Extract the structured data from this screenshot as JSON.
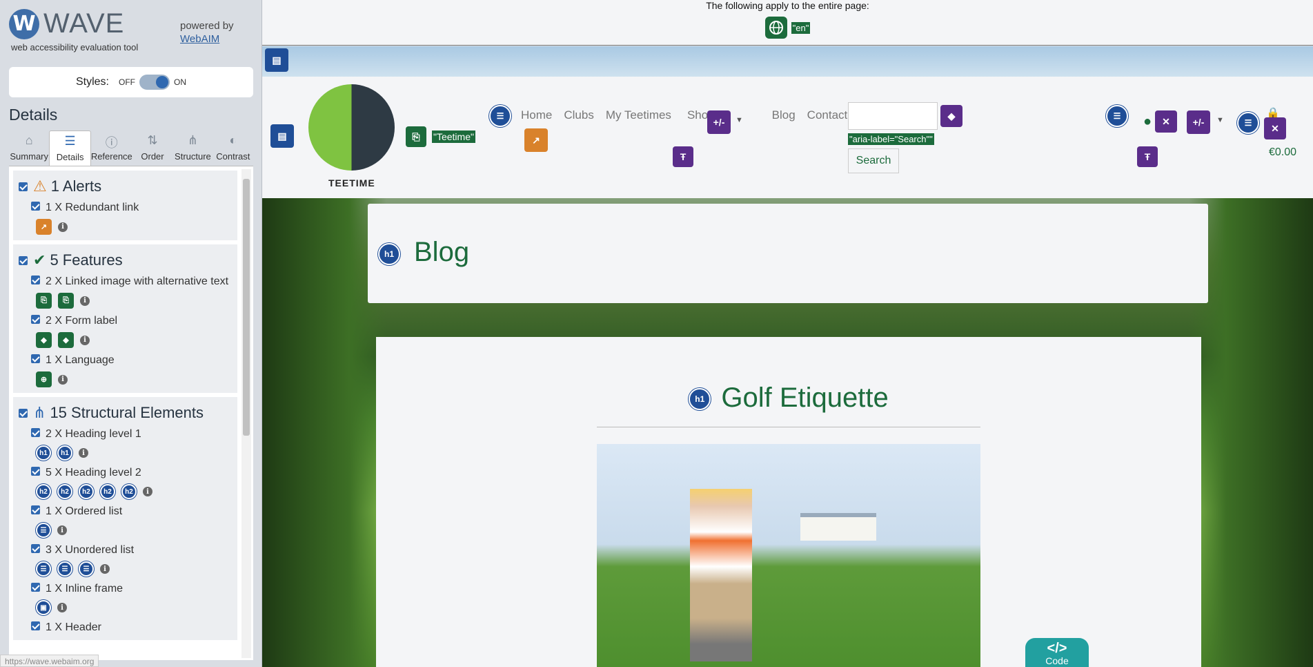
{
  "wave": {
    "logo_letter": "W",
    "logo_name": "WAVE",
    "tagline": "web accessibility evaluation tool",
    "powered_by": "powered by",
    "webaim": "WebAIM",
    "styles_label": "Styles:",
    "styles_off": "OFF",
    "styles_on": "ON",
    "details_heading": "Details",
    "tabs": [
      {
        "label": "Summary",
        "icon": "home-icon"
      },
      {
        "label": "Details",
        "icon": "list-icon"
      },
      {
        "label": "Reference",
        "icon": "info-icon"
      },
      {
        "label": "Order",
        "icon": "order-icon"
      },
      {
        "label": "Structure",
        "icon": "structure-icon"
      },
      {
        "label": "Contrast",
        "icon": "contrast-icon"
      }
    ],
    "alerts": {
      "title": "1 Alerts",
      "items": [
        {
          "label": "1 X Redundant link"
        }
      ]
    },
    "features": {
      "title": "5 Features",
      "items": [
        {
          "label": "2 X Linked image with alternative text"
        },
        {
          "label": "2 X Form label"
        },
        {
          "label": "1 X Language"
        }
      ]
    },
    "structural": {
      "title": "15 Structural Elements",
      "items": [
        {
          "label": "2 X Heading level 1",
          "badges": [
            "h1",
            "h1"
          ]
        },
        {
          "label": "5 X Heading level 2",
          "badges": [
            "h2",
            "h2",
            "h2",
            "h2",
            "h2"
          ]
        },
        {
          "label": "1 X Ordered list"
        },
        {
          "label": "3 X Unordered list"
        },
        {
          "label": "1 X Inline frame"
        },
        {
          "label": "1 X Header"
        }
      ]
    },
    "status_url": "https://wave.webaim.org"
  },
  "page": {
    "applies_text": "The following apply to the entire page:",
    "lang_tag": "\"en\"",
    "brand": "TEETIME",
    "teetime_tag": "\"Teetime\"",
    "nav": [
      "Home",
      "Clubs",
      "My Teetimes",
      "Shop",
      "Blog",
      "Contact"
    ],
    "aria_tag": "\"aria-label=\"Search\"\"",
    "search_button": "Search",
    "plus_minus": "+/-",
    "price": "€0.00",
    "blog_heading": "Blog",
    "h1_badge": "h1",
    "article_heading": "Golf Etiquette",
    "code_symbol": "</>",
    "code_label": "Code"
  },
  "colors": {
    "wave_blue": "#2f68b0",
    "feature_green": "#1c6b3c",
    "alert_orange": "#d9822b",
    "aria_purple": "#5a2d8a",
    "heading_green": "#1c6b3c"
  }
}
